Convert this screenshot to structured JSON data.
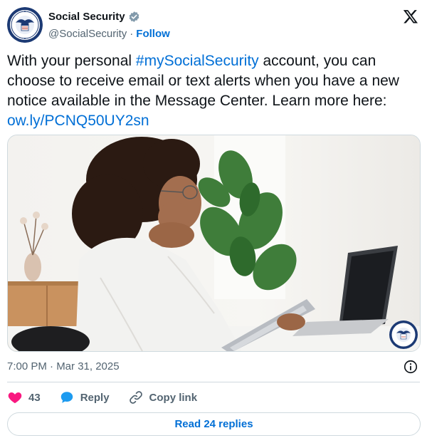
{
  "account": {
    "display_name": "Social Security",
    "handle": "@SocialSecurity",
    "separator": "·",
    "follow_label": "Follow"
  },
  "tweet": {
    "text_before": "With your personal ",
    "hashtag": "#mySocialSecurity",
    "text_after": " account, you can choose to receive email or text alerts when you have a new notice available in the Message Center. Learn more here: ",
    "link": "ow.ly/PCNQ50UY2sn",
    "timestamp": "7:00 PM · Mar 31, 2025"
  },
  "actions": {
    "like_count": "43",
    "reply_label": "Reply",
    "copy_link_label": "Copy link"
  },
  "footer": {
    "read_replies_label": "Read 24 replies"
  },
  "colors": {
    "link": "#006fd6",
    "heart": "#f91880",
    "reply_bubble": "#1d9bf0",
    "verified": "#829aab",
    "text": "#0f1419",
    "muted": "#536471"
  },
  "icons": {
    "verified": "verified-badge-icon",
    "x_logo": "x-logo-icon",
    "info": "info-icon",
    "like": "heart-icon",
    "reply": "speech-bubble-icon",
    "copy_link": "link-icon"
  }
}
